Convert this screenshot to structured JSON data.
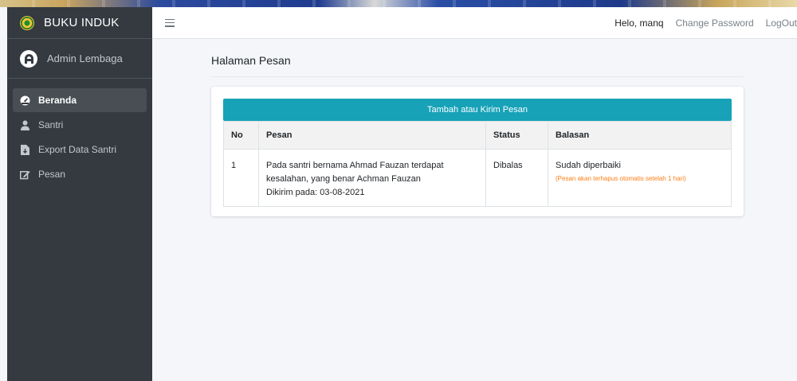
{
  "sidebar": {
    "brand": "BUKU INDUK",
    "user": "Admin Lembaga",
    "items": [
      {
        "label": "Beranda",
        "icon": "dashboard-icon"
      },
      {
        "label": "Santri",
        "icon": "user-icon"
      },
      {
        "label": "Export Data Santri",
        "icon": "file-export-icon"
      },
      {
        "label": "Pesan",
        "icon": "edit-icon"
      }
    ]
  },
  "navbar": {
    "greeting": "Helo, manq",
    "change_password": "Change Password",
    "logout": "LogOut"
  },
  "page": {
    "title": "Halaman Pesan",
    "add_button": "Tambah atau Kirim Pesan"
  },
  "table": {
    "headers": [
      "No",
      "Pesan",
      "Status",
      "Balasan"
    ],
    "rows": [
      {
        "no": "1",
        "pesan_line1": "Pada santri bernama Ahmad Fauzan terdapat",
        "pesan_line2": "kesalahan, yang benar Achman Fauzan",
        "pesan_line3": "Dikirim pada: 03-08-2021",
        "status": "Dibalas",
        "balasan": "Sudah diperbaiki",
        "note": "(Pesan akan terhapus otomatis setelah 1 hari)"
      }
    ]
  },
  "colors": {
    "sidebar_bg": "#343a40",
    "accent": "#17a2b8",
    "note": "#fd7e14"
  }
}
